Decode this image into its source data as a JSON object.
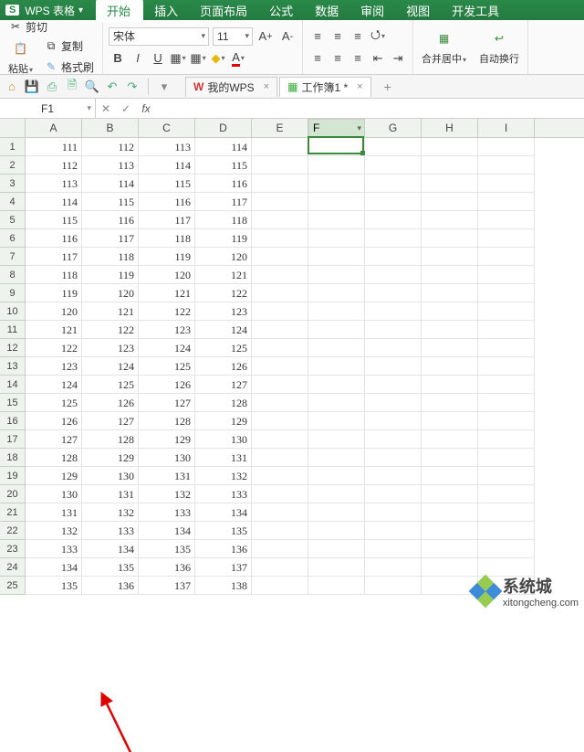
{
  "app": {
    "name": "WPS 表格"
  },
  "menu_tabs": [
    "开始",
    "插入",
    "页面布局",
    "公式",
    "数据",
    "审阅",
    "视图",
    "开发工具"
  ],
  "active_menu_tab": 0,
  "ribbon": {
    "clipboard": {
      "cut": "剪切",
      "copy": "复制",
      "paste": "粘贴",
      "format_painter": "格式刷"
    },
    "font": {
      "name": "宋体",
      "size": "11",
      "bold": "B",
      "italic": "I",
      "underline": "U"
    },
    "merge": {
      "label": "合并居中"
    },
    "wrap": {
      "label": "自动换行"
    }
  },
  "doc_tabs": [
    {
      "label": "我的WPS",
      "icon": "w"
    },
    {
      "label": "工作簿1 *",
      "icon": "s",
      "active": true
    }
  ],
  "namebox": "F1",
  "fx": "fx",
  "columns": [
    "A",
    "B",
    "C",
    "D",
    "E",
    "F",
    "G",
    "H",
    "I"
  ],
  "active_col_index": 5,
  "selected_cell": "F1",
  "chart_data": {
    "type": "table",
    "columns": [
      "A",
      "B",
      "C",
      "D"
    ],
    "rows": [
      [
        111,
        112,
        113,
        114
      ],
      [
        112,
        113,
        114,
        115
      ],
      [
        113,
        114,
        115,
        116
      ],
      [
        114,
        115,
        116,
        117
      ],
      [
        115,
        116,
        117,
        118
      ],
      [
        116,
        117,
        118,
        119
      ],
      [
        117,
        118,
        119,
        120
      ],
      [
        118,
        119,
        120,
        121
      ],
      [
        119,
        120,
        121,
        122
      ],
      [
        120,
        121,
        122,
        123
      ],
      [
        121,
        122,
        123,
        124
      ],
      [
        122,
        123,
        124,
        125
      ],
      [
        123,
        124,
        125,
        126
      ],
      [
        124,
        125,
        126,
        127
      ],
      [
        125,
        126,
        127,
        128
      ],
      [
        126,
        127,
        128,
        129
      ],
      [
        127,
        128,
        129,
        130
      ],
      [
        128,
        129,
        130,
        131
      ],
      [
        129,
        130,
        131,
        132
      ],
      [
        130,
        131,
        132,
        133
      ],
      [
        131,
        132,
        133,
        134
      ],
      [
        132,
        133,
        134,
        135
      ],
      [
        133,
        134,
        135,
        136
      ],
      [
        134,
        135,
        136,
        137
      ],
      [
        135,
        136,
        137,
        138
      ]
    ]
  },
  "watermark": {
    "brand": "系统城",
    "url": "xitongcheng.com"
  }
}
